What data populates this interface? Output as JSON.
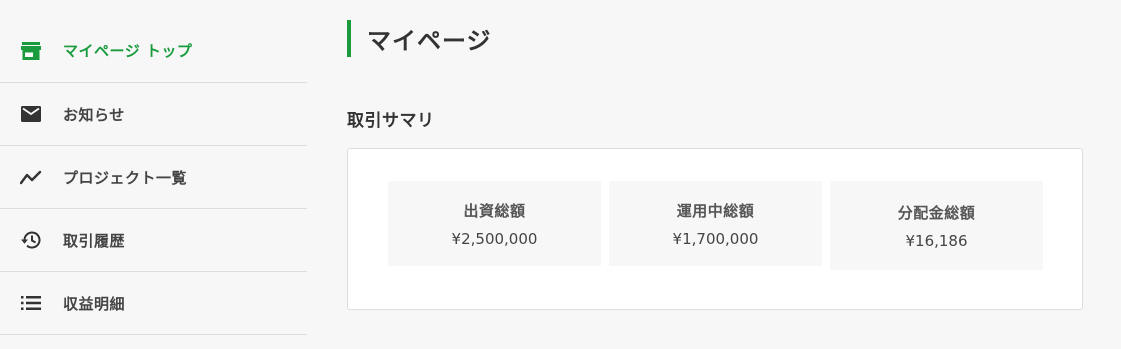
{
  "sidebar": {
    "items": [
      {
        "label": "マイページ トップ",
        "icon": "store-icon",
        "active": true
      },
      {
        "label": "お知らせ",
        "icon": "mail-icon",
        "active": false
      },
      {
        "label": "プロジェクト一覧",
        "icon": "trending-line-icon",
        "active": false
      },
      {
        "label": "取引履歴",
        "icon": "history-icon",
        "active": false
      },
      {
        "label": "収益明細",
        "icon": "list-icon",
        "active": false
      }
    ]
  },
  "main": {
    "title": "マイページ",
    "section_title": "取引サマリ",
    "stats": [
      {
        "label": "出資総額",
        "value": "¥2,500,000"
      },
      {
        "label": "運用中総額",
        "value": "¥1,700,000"
      },
      {
        "label": "分配金総額",
        "value": "¥16,186"
      }
    ]
  },
  "colors": {
    "accent": "#1a9c3e",
    "text": "#333333",
    "background": "#f7f7f7",
    "card": "#ffffff",
    "border": "#dddddd"
  }
}
